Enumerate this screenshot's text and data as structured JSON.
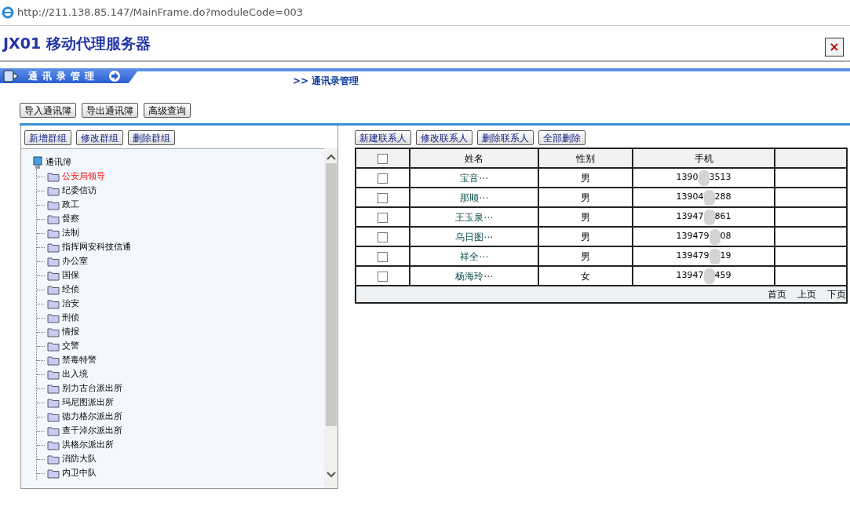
{
  "address_bar": {
    "url": "http://211.138.85.147/MainFrame.do?moduleCode=003"
  },
  "header": {
    "title": "JX01 移动代理服务器",
    "close": "×"
  },
  "module_tab": {
    "label": "通讯录管理"
  },
  "breadcrumb": {
    "arrow": ">>",
    "label": "通讯录管理"
  },
  "toolbar": [
    "导入通讯簿",
    "导出通讯簿",
    "高级查询"
  ],
  "group_buttons": [
    "新增群组",
    "修改群组",
    "删除群组"
  ],
  "tree": {
    "label": "通讯簿",
    "children": [
      {
        "label": "公安局领导",
        "selected": true
      },
      {
        "label": "纪委信访",
        "selected": false
      },
      {
        "label": "政工",
        "selected": false
      },
      {
        "label": "督察",
        "selected": false
      },
      {
        "label": "法制",
        "selected": false
      },
      {
        "label": "指挥网安科技信通",
        "selected": false
      },
      {
        "label": "办公室",
        "selected": false
      },
      {
        "label": "国保",
        "selected": false
      },
      {
        "label": "经侦",
        "selected": false
      },
      {
        "label": "治安",
        "selected": false
      },
      {
        "label": "刑侦",
        "selected": false
      },
      {
        "label": "情报",
        "selected": false
      },
      {
        "label": "交警",
        "selected": false
      },
      {
        "label": "禁毒特警",
        "selected": false
      },
      {
        "label": "出入境",
        "selected": false
      },
      {
        "label": "别力古台派出所",
        "selected": false
      },
      {
        "label": "玛尼图派出所",
        "selected": false
      },
      {
        "label": "德力格尔派出所",
        "selected": false
      },
      {
        "label": "查干淖尔派出所",
        "selected": false
      },
      {
        "label": "洪格尔派出所",
        "selected": false
      },
      {
        "label": "消防大队",
        "selected": false
      },
      {
        "label": "内卫中队",
        "selected": false
      }
    ]
  },
  "contact_buttons": [
    "新建联系人",
    "修改联系人",
    "删除联系人",
    "全部删除"
  ],
  "table": {
    "columns": [
      "姓名",
      "性别",
      "手机"
    ],
    "rows": [
      {
        "checked": false,
        "name": "宝音⋯",
        "gender": "男",
        "phone_start": "1390",
        "phone_end": "3513"
      },
      {
        "checked": false,
        "name": "那顺⋯",
        "gender": "男",
        "phone_start": "13904",
        "phone_end": "288"
      },
      {
        "checked": false,
        "name": "王玉泉⋯",
        "gender": "男",
        "phone_start": "13947",
        "phone_end": "861"
      },
      {
        "checked": false,
        "name": "乌日图⋯",
        "gender": "男",
        "phone_start": "139479",
        "phone_end": "08"
      },
      {
        "checked": false,
        "name": "祥全⋯",
        "gender": "男",
        "phone_start": "139479",
        "phone_end": "19"
      },
      {
        "checked": false,
        "name": "杨海玲⋯",
        "gender": "女",
        "phone_start": "13947",
        "phone_end": "459"
      }
    ],
    "select_all": false,
    "pager": [
      "首页",
      "上页",
      "下页"
    ]
  }
}
